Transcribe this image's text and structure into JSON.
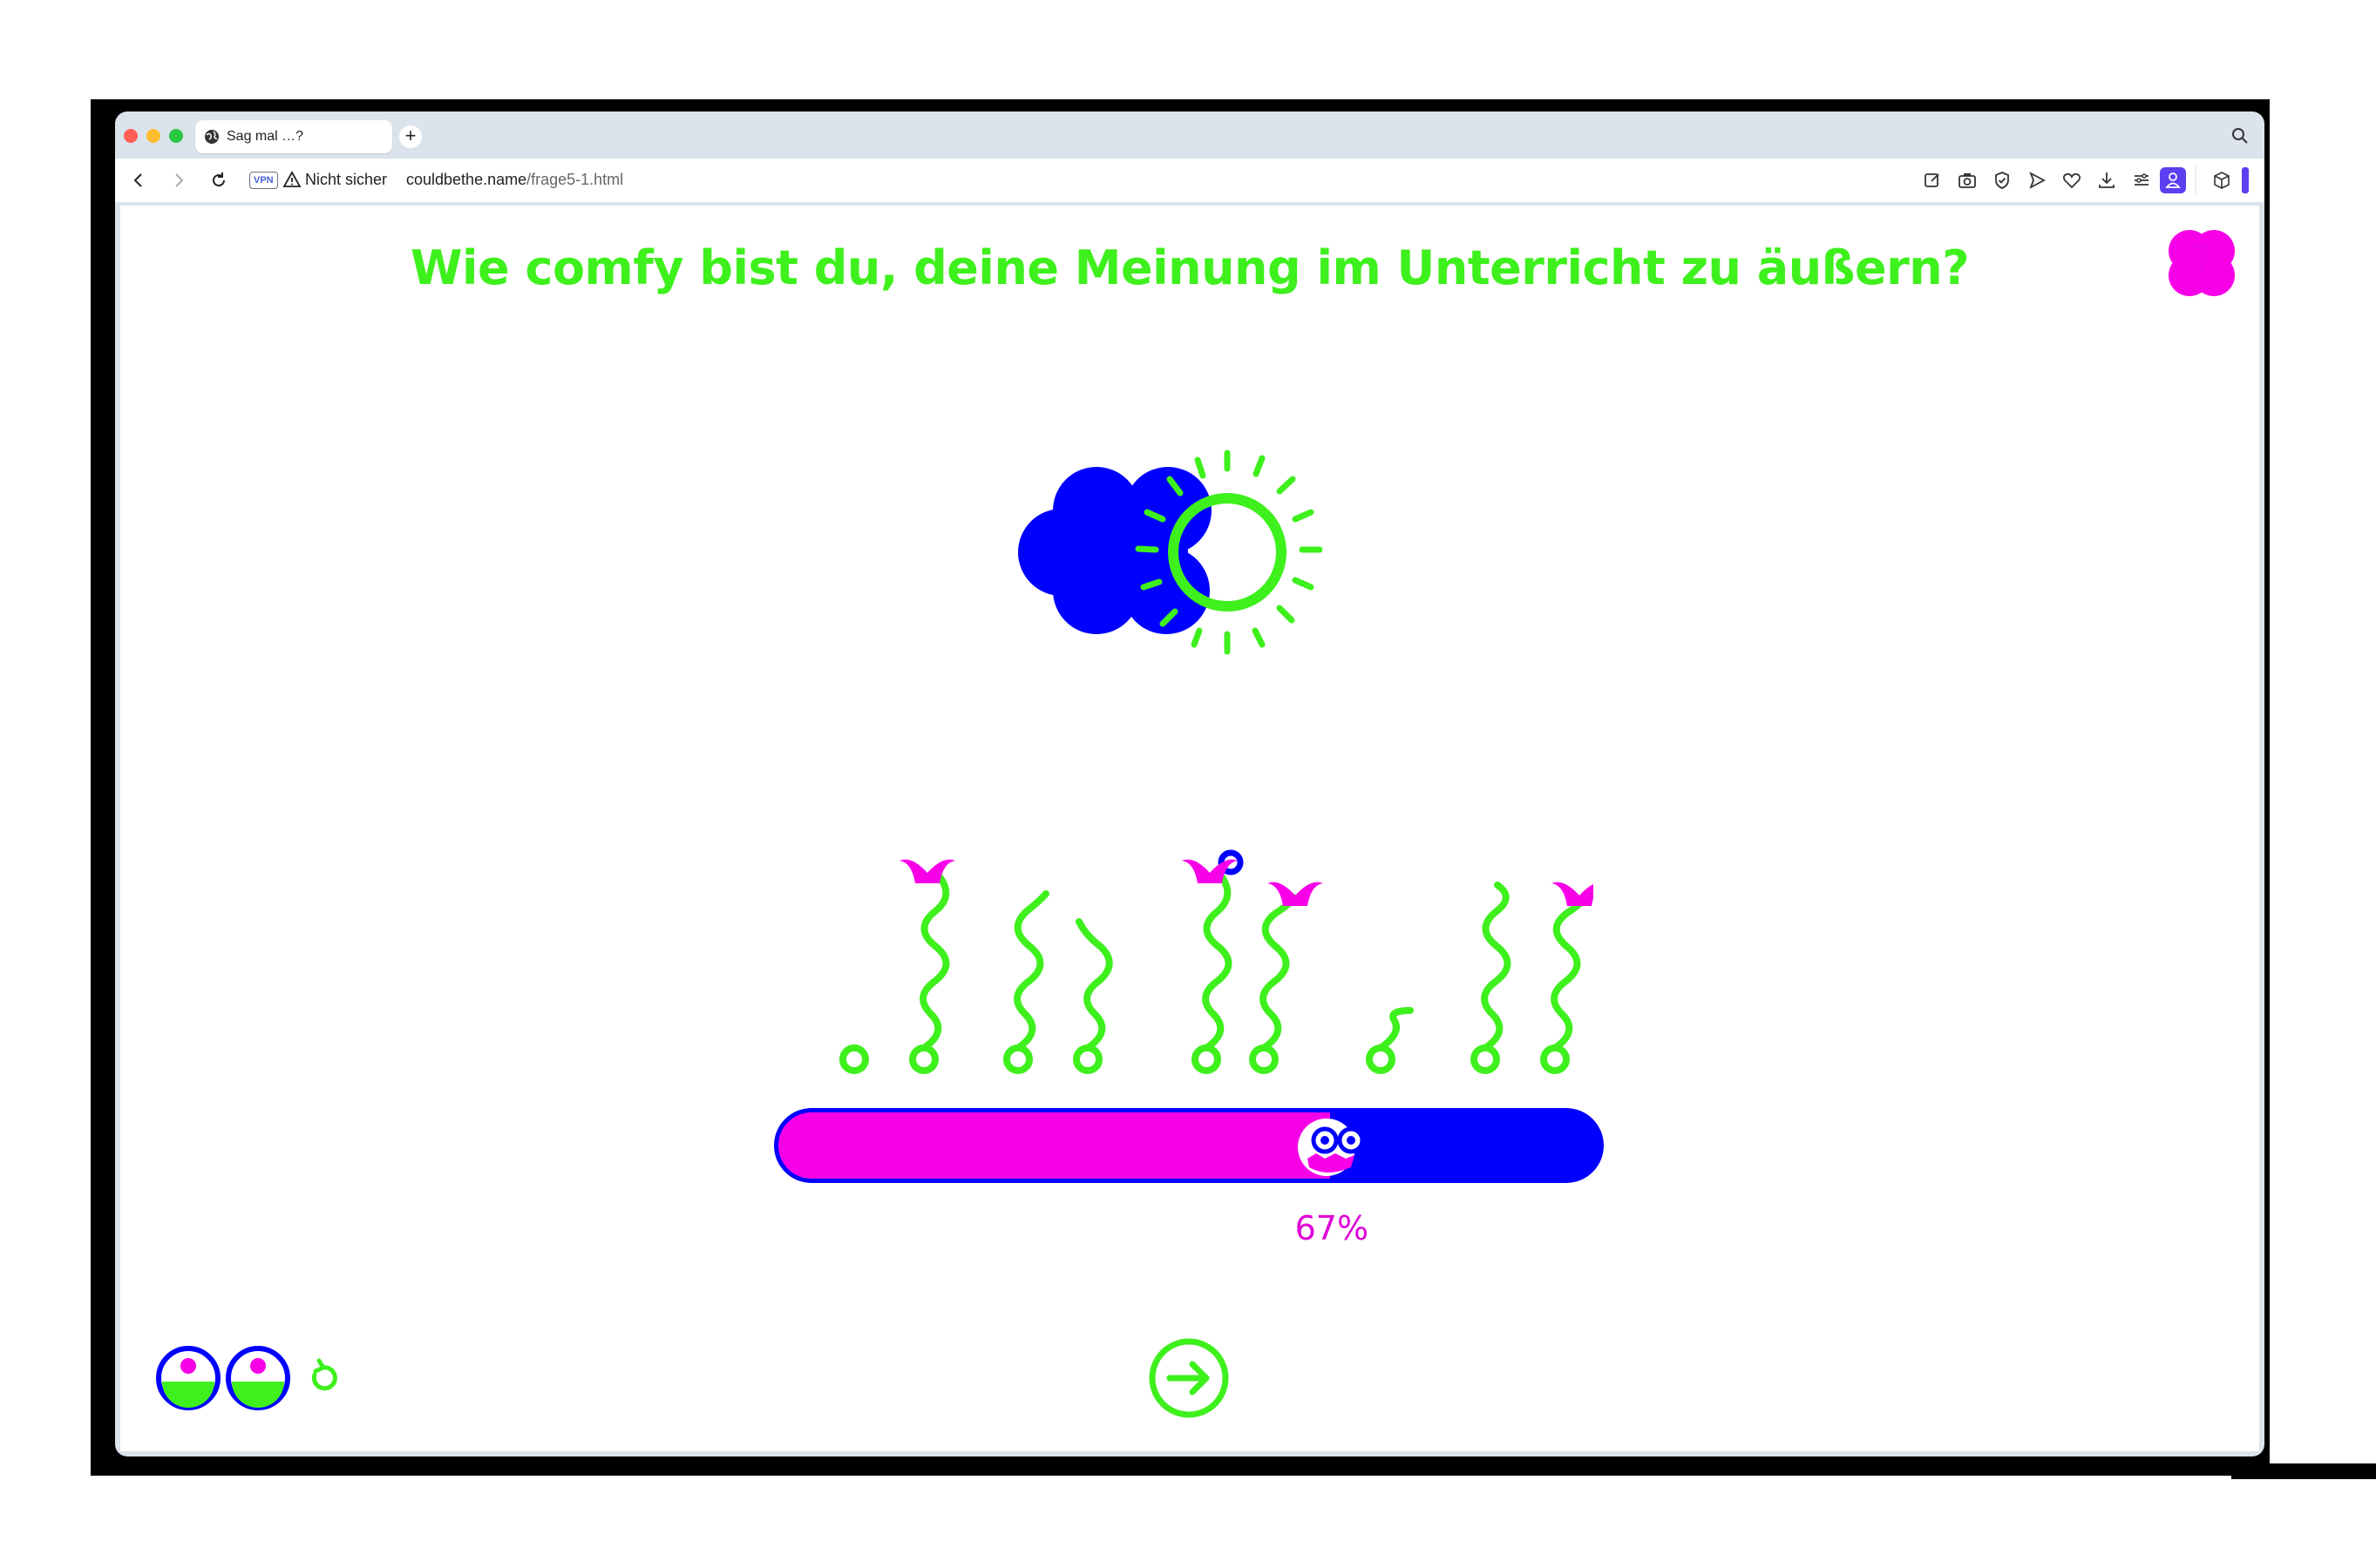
{
  "browser": {
    "tab_title": "Sag mal …?",
    "new_tab": "+",
    "vpn_badge": "VPN",
    "security_text": "Nicht sicher",
    "url_host": "couldbethe.name",
    "url_path": "/frage5-1.html"
  },
  "page": {
    "question": "Wie comfy bist du, deine Meinung im Unterricht zu äußern?",
    "help_label": "?",
    "slider": {
      "value_percent": 67,
      "label": "67%"
    }
  },
  "colors": {
    "green": "#3ef01c",
    "blue": "#0000ff",
    "magenta": "#f700e8"
  },
  "icons": [
    "globe-icon",
    "back-icon",
    "forward-icon",
    "reload-icon",
    "warning-icon",
    "edit-icon",
    "camera-icon",
    "shield-icon",
    "send-icon",
    "heart-icon",
    "download-icon",
    "menu-icon",
    "profile-icon",
    "cube-icon",
    "search-icon",
    "help-icon",
    "weather-icon",
    "restart-icon",
    "next-arrow-icon"
  ]
}
